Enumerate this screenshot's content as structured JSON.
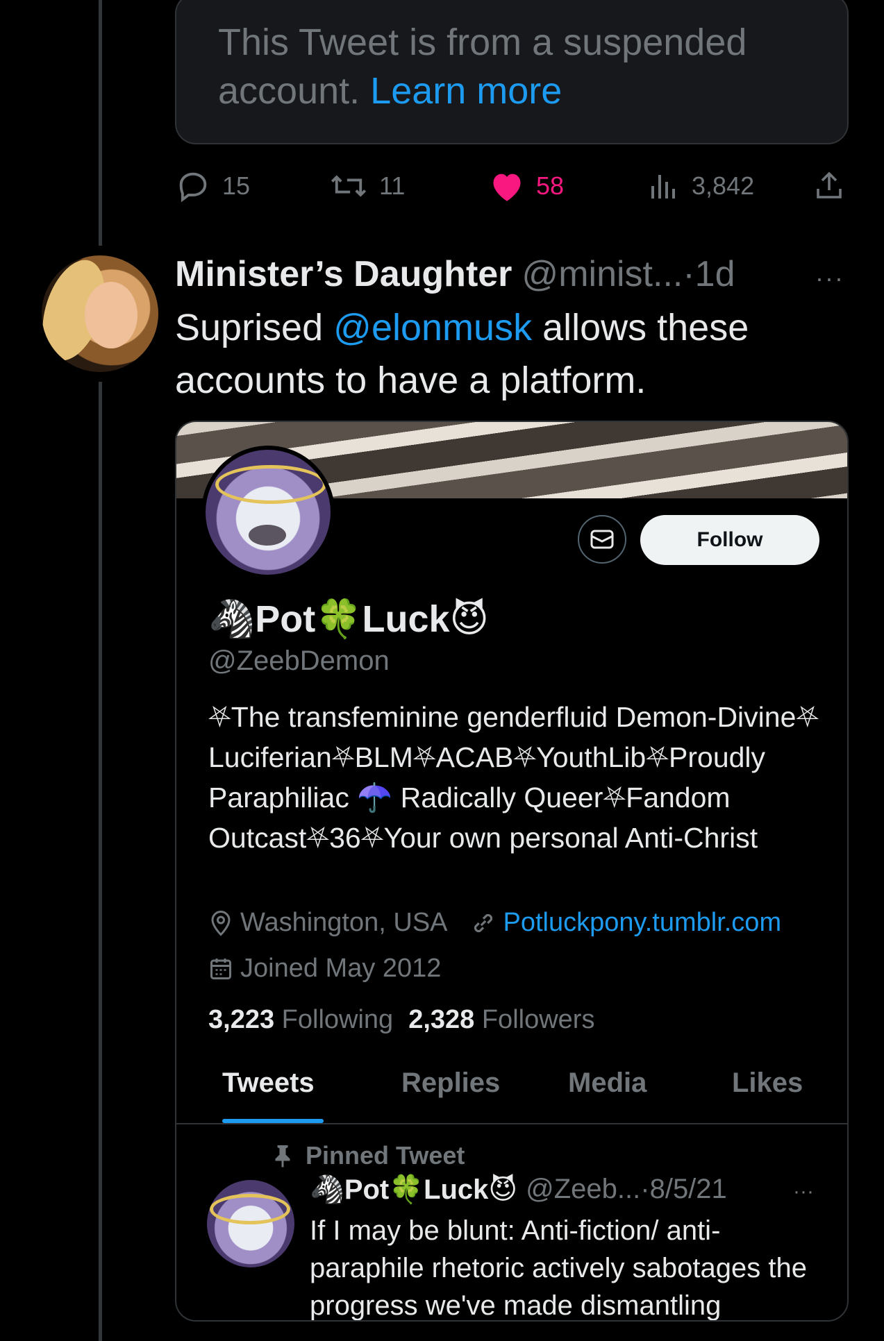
{
  "suspended": {
    "text": "This Tweet is from a suspended account.",
    "link": "Learn more"
  },
  "actions": {
    "replies": "15",
    "retweets": "11",
    "likes": "58",
    "views": "3,842"
  },
  "reply_tweet": {
    "author_name": "Minister’s Daughter",
    "handle": "@minist...",
    "separator": "·",
    "time": "1d",
    "more": "···",
    "text_before": "Suprised ",
    "mention": "@elonmusk",
    "text_after": " allows these accounts to have a platform."
  },
  "profile_card": {
    "follow_label": "Follow",
    "name_prefix": "🦓",
    "name_part1": "Pot",
    "name_clover": "🍀",
    "name_part2": "Luck",
    "name_suffix": "😈",
    "handle": "@ZeebDemon",
    "bio_line1": "⛧The transfeminine genderfluid Demon-Divine⛧",
    "bio_line2": "Luciferian⛧BLM⛧ACAB⛧YouthLib⛧Proudly Paraphiliac ☂️ Radically Queer⛧Fandom Outcast⛧36⛧Your own personal Anti-Christ",
    "location": "Washington, USA",
    "website": "Potluckpony.tumblr.com",
    "joined": "Joined May 2012",
    "following_count": "3,223",
    "following_label": "Following",
    "followers_count": "2,328",
    "followers_label": "Followers",
    "tabs": [
      "Tweets",
      "Replies",
      "Media",
      "Likes"
    ],
    "pinned_label": "Pinned Tweet",
    "pinned_author_prefix": "🦓",
    "pinned_author_part1": "Pot",
    "pinned_author_clover": "🍀",
    "pinned_author_part2": "Luck",
    "pinned_author_suffix": "😈",
    "pinned_handle": "@Zeeb...",
    "pinned_separator": "·",
    "pinned_date": "8/5/21",
    "pinned_more": "···",
    "pinned_text": "If I may be blunt: Anti-fiction/ anti-paraphile rhetoric actively sabotages the progress we've made dismantling"
  },
  "colors": {
    "background": "#000000",
    "link": "#1d9bf0",
    "like": "#f91880",
    "muted": "#71767b"
  }
}
